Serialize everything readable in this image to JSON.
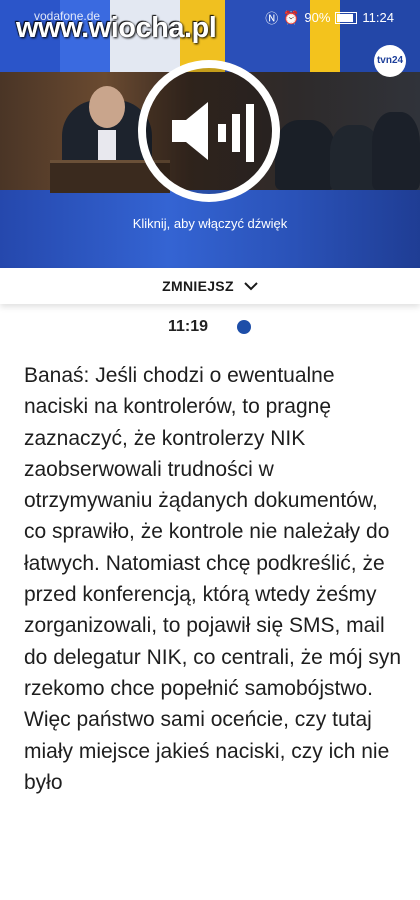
{
  "status_bar": {
    "carrier": "vodafone.de",
    "battery": "90%",
    "time": "11:24",
    "watermark": "www.wiocha.pl"
  },
  "video": {
    "channel_logo": "tvn24",
    "unmute_hint": "Kliknij, aby włączyć dźwięk",
    "icon": "speaker-icon"
  },
  "collapse": {
    "label": "ZMNIEJSZ"
  },
  "post": {
    "time": "11:19",
    "text": "Banaś: Jeśli chodzi o ewentualne naciski na kontrolerów, to pragnę zaznaczyć, że kontrolerzy NIK zaobserwowali trudności w otrzymywaniu żądanych dokumentów, co sprawiło, że kontrole nie należały do łatwych. Natomiast chcę podkreślić, że przed konferencją, którą wtedy żeśmy zorganizowali, to pojawił się SMS, mail do delegatur NIK, co centrali, że mój syn rzekomo chce popełnić samobójstwo. Więc państwo sami oceńcie, czy tutaj miały miejsce jakieś naciski, czy ich nie było"
  },
  "colors": {
    "accent": "#1d4ea8"
  }
}
